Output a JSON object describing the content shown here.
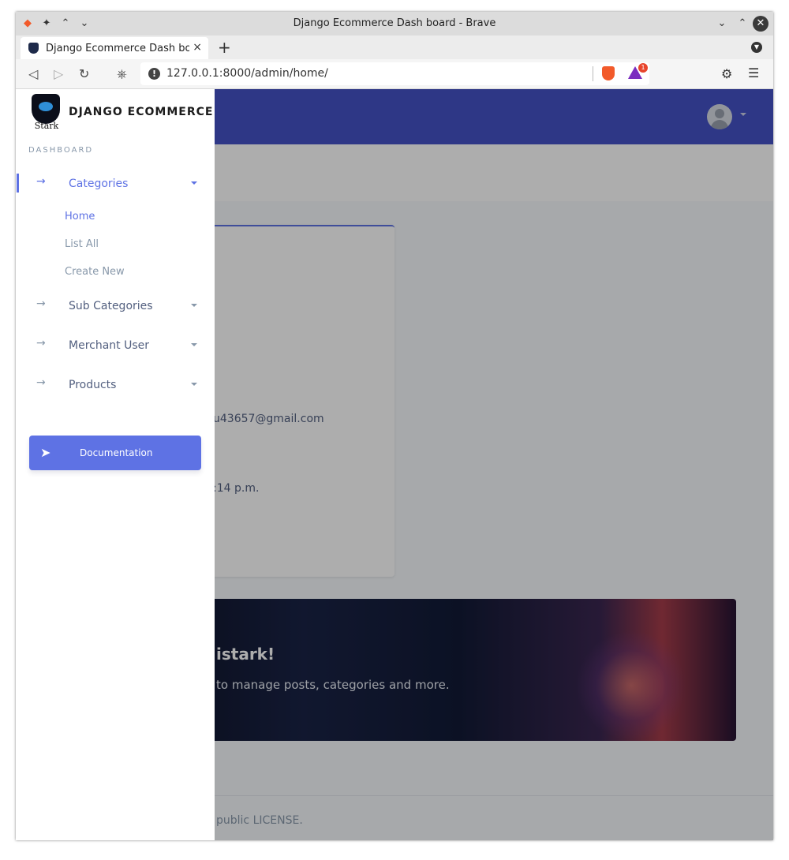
{
  "window": {
    "title": "Django Ecommerce Dash board - Brave",
    "icons": [
      "brave-logo-icon",
      "pin-icon",
      "keep-above-icon",
      "keep-below-icon",
      "minimize-icon",
      "maximize-icon",
      "close-icon"
    ]
  },
  "tabs": [
    {
      "label": "Django Ecommerce Dash board",
      "close": "×"
    }
  ],
  "tabbar": {
    "new_tab": "+"
  },
  "toolbar": {
    "url": "127.0.0.1:8000/admin/home/",
    "rewards_badge": "1"
  },
  "brand": {
    "logo_text": "Stark",
    "name": "DJANGO ECOMMERCE"
  },
  "sidebar": {
    "heading": "DASHBOARD",
    "items": [
      {
        "label": "Categories",
        "active": true
      },
      {
        "label": "Sub Categories",
        "active": false
      },
      {
        "label": "Merchant User",
        "active": false
      },
      {
        "label": "Products",
        "active": false
      }
    ],
    "subitems": [
      {
        "label": "Home",
        "active": true
      },
      {
        "label": "List All",
        "active": false
      },
      {
        "label": "Create New",
        "active": false
      }
    ],
    "doc_button": "Documentation"
  },
  "profile_card": {
    "email_fragment": "u43657@gmail.com",
    "date_fragment": ":14 p.m."
  },
  "hero": {
    "title_fragment": "istark!",
    "subtitle_fragment": "to manage posts, categories and more."
  },
  "footer": {
    "text_fragment": "public LICENSE."
  },
  "colors": {
    "primary": "#5e72e4",
    "topnav": "#4451c6",
    "muted_text": "#8898aa",
    "body_text": "#525f7f"
  }
}
